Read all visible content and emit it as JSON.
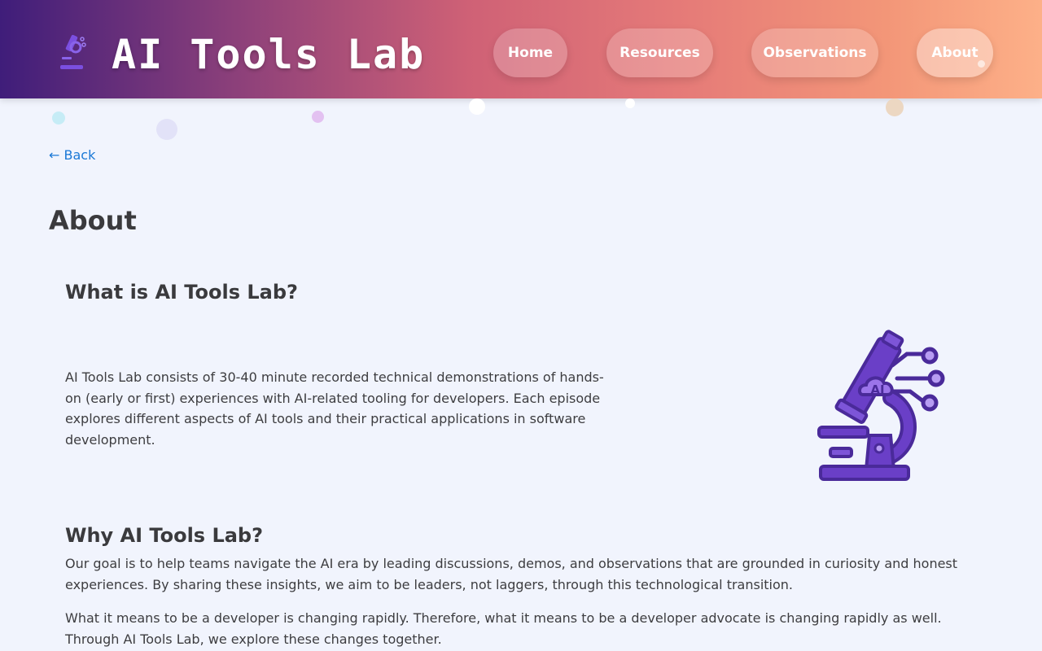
{
  "header": {
    "brand": "AI Tools Lab",
    "logo_icon": "microscope-icon",
    "nav": [
      {
        "label": "Home",
        "active": false
      },
      {
        "label": "Resources",
        "active": false
      },
      {
        "label": "Observations",
        "active": false
      },
      {
        "label": "About",
        "active": true
      }
    ]
  },
  "back_link": "← Back",
  "page_title": "About",
  "sections": [
    {
      "heading": "What is AI Tools Lab?",
      "paragraphs": [
        "AI Tools Lab consists of 30-40 minute recorded technical demonstrations of hands-on (early or first) experiences with AI-related tooling for developers. Each episode explores different aspects of AI tools and their practical applications in software development."
      ],
      "illustration": "microscope-ai-icon",
      "illustration_text": "AI"
    },
    {
      "heading": "Why AI Tools Lab?",
      "paragraphs": [
        "Our goal is to help teams navigate the AI era by leading discussions, demos, and observations that are grounded in curiosity and honest experiences. By sharing these insights, we aim to be leaders, not laggers, through this technological transition.",
        "What it means to be a developer is changing rapidly. Therefore, what it means to be a developer advocate is changing rapidly as well. Through AI Tools Lab, we explore these changes together."
      ]
    }
  ],
  "colors": {
    "background": "#f1f4fd",
    "link": "#1a78d6",
    "heading": "#3a3a3d",
    "illustration": "#6a3fc7"
  }
}
